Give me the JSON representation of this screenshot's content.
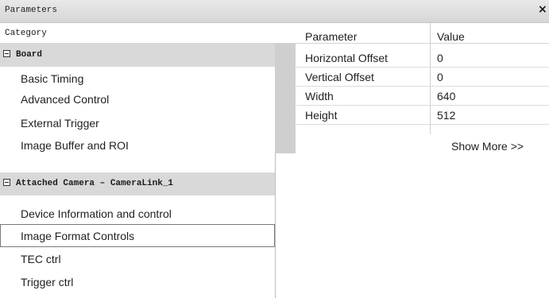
{
  "window": {
    "title": "Parameters",
    "close_glyph": "×"
  },
  "header": {
    "category": "Category",
    "parameter": "Parameter",
    "value": "Value"
  },
  "category": {
    "groups": [
      {
        "label": "Board",
        "items": [
          "Basic Timing",
          "Advanced Control",
          "External Trigger",
          "Image Buffer and ROI"
        ]
      },
      {
        "label": "Attached Camera – CameraLink_1",
        "items": [
          "Device Information and control",
          "Image Format Controls",
          "TEC ctrl",
          "Trigger ctrl"
        ]
      }
    ],
    "selected_item": "Image Format Controls"
  },
  "parameters": [
    {
      "name": "Horizontal Offset",
      "value": "0"
    },
    {
      "name": "Vertical Offset",
      "value": "0"
    },
    {
      "name": "Width",
      "value": "640"
    },
    {
      "name": "Height",
      "value": "512"
    }
  ],
  "show_more": "Show More >>",
  "icons": {
    "collapse": "minus-box-icon",
    "close": "close-icon"
  }
}
